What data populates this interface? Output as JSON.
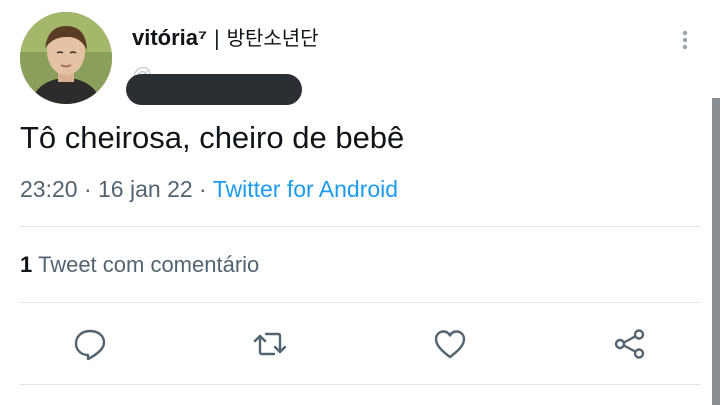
{
  "tweet": {
    "display_name": "vitória⁷",
    "name_suffix": " | 방탄소년단",
    "handle_visible": "@",
    "text": "Tô cheirosa, cheiro de bebê",
    "time": "23:20",
    "date": "16 jan 22",
    "source": "Twitter for Android",
    "quote_count": "1",
    "quote_label": " Tweet com comentário"
  },
  "actions": [
    {
      "name": "reply",
      "icon": "reply-icon"
    },
    {
      "name": "retweet",
      "icon": "retweet-icon"
    },
    {
      "name": "like",
      "icon": "heart-icon"
    },
    {
      "name": "share",
      "icon": "share-icon"
    }
  ],
  "colors": {
    "text": "#0f1419",
    "secondary": "#536471",
    "link": "#1d9bf0",
    "divider": "#e1e5e8"
  }
}
